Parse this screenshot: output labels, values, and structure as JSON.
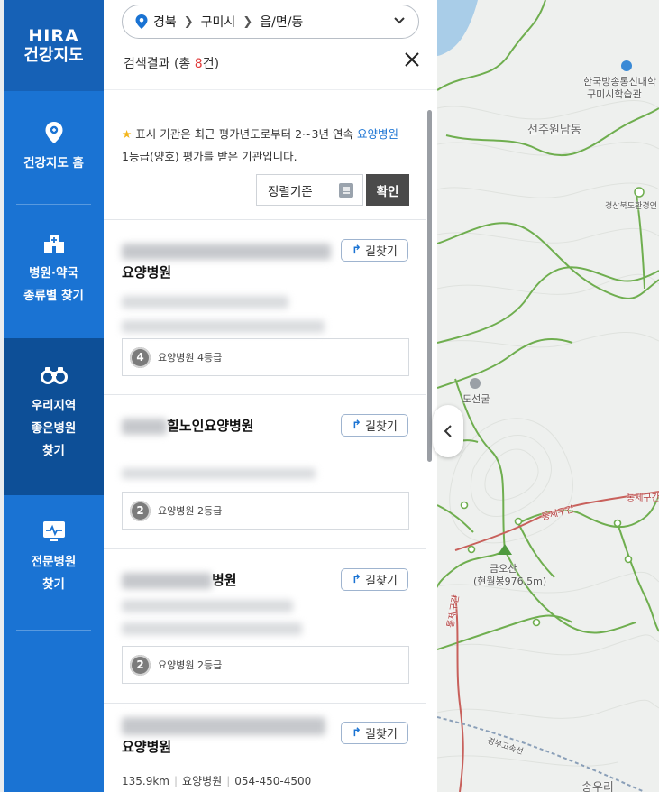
{
  "nav": {
    "logo_line1": "HIRA",
    "logo_line2": "건강지도",
    "items": [
      {
        "label": "건강지도 홈",
        "icon": "location-pin-icon"
      },
      {
        "label": "병원·약국\n종류별 찾기",
        "icon": "hospital-building-icon"
      },
      {
        "label": "우리지역\n좋은병원\n찾기",
        "icon": "binoculars-icon",
        "active": true
      },
      {
        "label": "전문병원\n찾기",
        "icon": "heart-monitor-icon"
      }
    ]
  },
  "location": {
    "province": "경북",
    "city": "구미시",
    "district": "읍/면/동"
  },
  "results": {
    "prefix": "검색결과 (총 ",
    "count": "8",
    "suffix": "건)"
  },
  "notice": {
    "line1_prefix": "표시 기관은 최근 평가년도로부터 2~3년 연속 ",
    "line1_highlight": "요양병원",
    "line2": "1등급(양호) 평가를 받은 기관입니다."
  },
  "sort": {
    "label": "정렬기준",
    "confirm": "확인"
  },
  "cards": [
    {
      "title_visible": "요양병원",
      "directions": "길찾기",
      "grade_number": "4",
      "grade_text": "요양병원 4등급"
    },
    {
      "title_visible": "힐노인요양병원",
      "directions": "길찾기",
      "grade_number": "2",
      "grade_text": "요양병원 2등급"
    },
    {
      "title_visible": "병원",
      "directions": "길찾기",
      "grade_number": "2",
      "grade_text": "요양병원 2등급"
    },
    {
      "title_visible": "요양병원",
      "directions": "길찾기",
      "distance": "135.9km",
      "type": "요양병원",
      "phone": "054-450-4500"
    }
  ],
  "map": {
    "labels": [
      "한국방송통신대학",
      "구미시학습관",
      "선주원남동",
      "경상북도환경연",
      "도선굴",
      "금오산",
      "(현월봉976.5m)",
      "통제구간",
      "통제구간",
      "통제구간",
      "경부고속선",
      "송우리"
    ]
  },
  "colors": {
    "nav_bg": "#1a73d3",
    "nav_active": "#0d4f97",
    "accent_red": "#e03a3a",
    "highlight_blue": "#1a73d3",
    "trail_green": "#6fae4f"
  }
}
